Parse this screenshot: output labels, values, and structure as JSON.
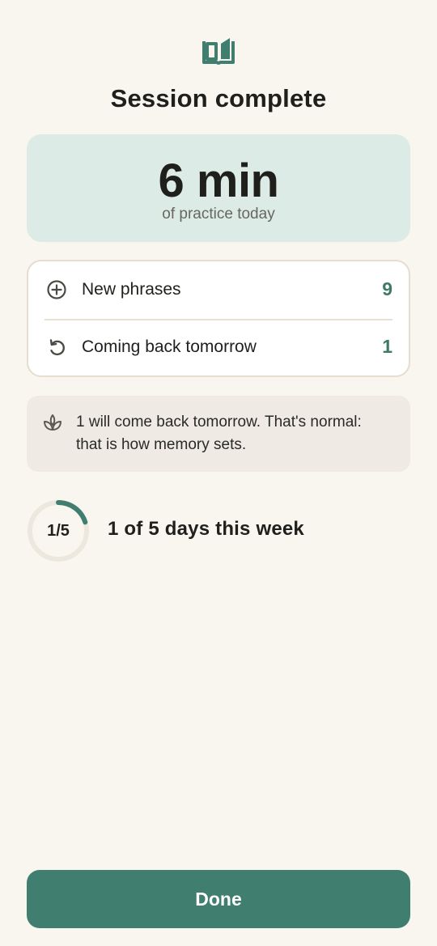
{
  "header": {
    "icon": "open-book-icon",
    "title": "Session complete"
  },
  "summary": {
    "value": "6 min",
    "caption": "of practice today"
  },
  "stats": [
    {
      "icon": "plus-circle-icon",
      "label": "New phrases",
      "value": "9"
    },
    {
      "icon": "refresh-icon",
      "label": "Coming back tomorrow",
      "value": "1"
    }
  ],
  "note": {
    "icon": "sprout-icon",
    "text": "1 will come back tomorrow. That's normal: that is how memory sets."
  },
  "weekly_progress": {
    "completed": 1,
    "total": 5,
    "fraction_text": "1/5",
    "label": "1 of 5 days this week"
  },
  "actions": {
    "done_label": "Done"
  },
  "colors": {
    "background": "#f9f6ef",
    "accent": "#407f6f",
    "summary_card": "#dcebe5",
    "note_card": "#efebe4",
    "value_green": "#3f7a68"
  }
}
